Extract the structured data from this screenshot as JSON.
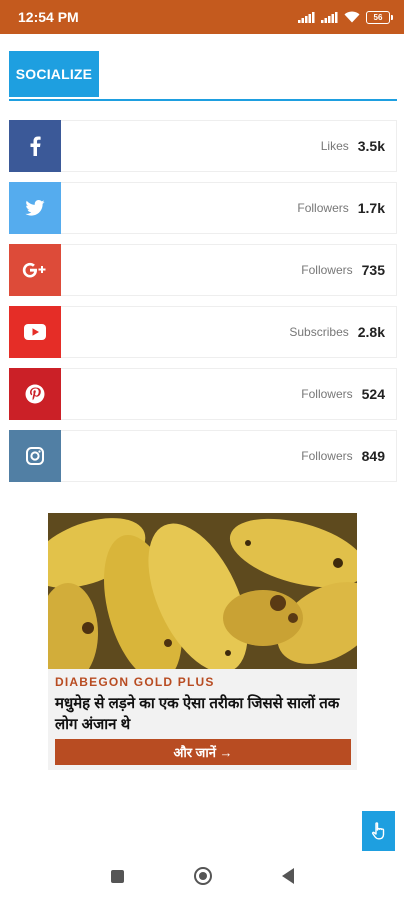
{
  "status_bar": {
    "time": "12:54 PM",
    "battery": "56"
  },
  "section": {
    "title": "SOCIALIZE"
  },
  "social": [
    {
      "network": "facebook",
      "icon": "facebook-icon",
      "color": "#3b5998",
      "label": "Likes",
      "value": "3.5k"
    },
    {
      "network": "twitter",
      "icon": "twitter-icon",
      "color": "#55acee",
      "label": "Followers",
      "value": "1.7k"
    },
    {
      "network": "google-plus",
      "icon": "google-plus-icon",
      "color": "#dd4b39",
      "label": "Followers",
      "value": "735"
    },
    {
      "network": "youtube",
      "icon": "youtube-icon",
      "color": "#e52d27",
      "label": "Subscribes",
      "value": "2.8k"
    },
    {
      "network": "pinterest",
      "icon": "pinterest-icon",
      "color": "#cb2027",
      "label": "Followers",
      "value": "524"
    },
    {
      "network": "instagram",
      "icon": "instagram-icon",
      "color": "#517fa4",
      "label": "Followers",
      "value": "849"
    }
  ],
  "ad": {
    "brand": "DIABEGON GOLD PLUS",
    "headline": "मधुमेह से लड़ने का एक ऐसा तरीका जिससे सालों तक लोग अंजान थे",
    "cta": "और जानें →"
  },
  "colors": {
    "status_bar": "#c45a1e",
    "accent": "#1e9fe0",
    "ad_cta": "#b84c22"
  }
}
